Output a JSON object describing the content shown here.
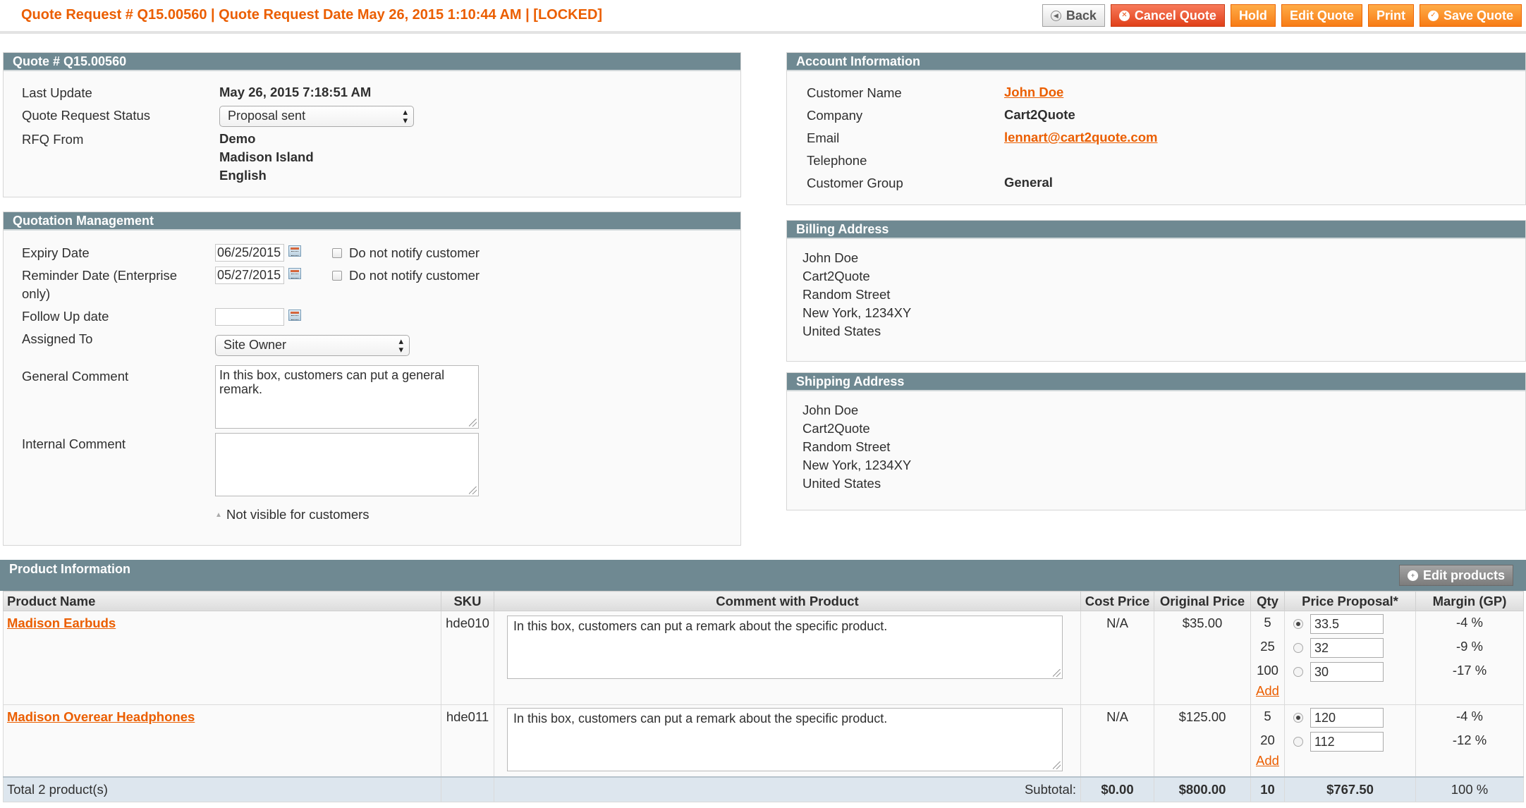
{
  "header": {
    "title": "Quote Request # Q15.00560 | Quote Request Date May 26, 2015 1:10:44 AM | [LOCKED]",
    "buttons": {
      "back": "Back",
      "cancel": "Cancel Quote",
      "hold": "Hold",
      "edit": "Edit Quote",
      "print": "Print",
      "save": "Save Quote"
    }
  },
  "quote": {
    "heading": "Quote # Q15.00560",
    "last_update_label": "Last Update",
    "last_update": "May 26, 2015 7:18:51 AM",
    "status_label": "Quote Request Status",
    "status": "Proposal sent",
    "rfq_label": "RFQ From",
    "rfq_from": [
      "Demo",
      "Madison Island",
      "English"
    ]
  },
  "management": {
    "heading": "Quotation Management",
    "expiry_label": "Expiry Date",
    "expiry_value": "06/25/2015",
    "reminder_label_1": "Reminder Date (Enterprise",
    "reminder_label_2": "only)",
    "reminder_value": "05/27/2015",
    "notify_label": "Do not notify customer",
    "followup_label": "Follow Up date",
    "followup_value": "",
    "assigned_label": "Assigned To",
    "assigned_value": "Site Owner",
    "general_label": "General Comment",
    "general_value": "In this box, customers can put a general remark.",
    "internal_label": "Internal Comment",
    "internal_value": "",
    "internal_note": "Not visible for customers"
  },
  "account": {
    "heading": "Account Information",
    "name_label": "Customer Name",
    "name": "John Doe",
    "company_label": "Company",
    "company": "Cart2Quote",
    "email_label": "Email",
    "email": "lennart@cart2quote.com",
    "phone_label": "Telephone",
    "phone": "",
    "group_label": "Customer Group",
    "group": "General"
  },
  "billing": {
    "heading": "Billing Address",
    "lines": [
      "John Doe",
      "Cart2Quote",
      "Random Street",
      "New York, 1234XY",
      "United States"
    ]
  },
  "shipping": {
    "heading": "Shipping Address",
    "lines": [
      "John Doe",
      "Cart2Quote",
      "Random Street",
      "New York, 1234XY",
      "United States"
    ]
  },
  "products": {
    "heading": "Product Information",
    "edit_button": "Edit products",
    "columns": [
      "Product Name",
      "SKU",
      "Comment with Product",
      "Cost Price",
      "Original Price",
      "Qty",
      "Price Proposal*",
      "Margin (GP)"
    ],
    "add_label": "Add",
    "rows": [
      {
        "name": "Madison Earbuds",
        "sku": "hde010",
        "comment": "In this box, customers can put a remark about the specific product.",
        "cost": "N/A",
        "original": "$35.00",
        "tiers": [
          {
            "qty": "5",
            "proposal": "33.5",
            "margin": "-4 %",
            "selected": true
          },
          {
            "qty": "25",
            "proposal": "32",
            "margin": "-9 %",
            "selected": false
          },
          {
            "qty": "100",
            "proposal": "30",
            "margin": "-17 %",
            "selected": false
          }
        ]
      },
      {
        "name": "Madison Overear Headphones",
        "sku": "hde011",
        "comment": "In this box, customers can put a remark about the specific product.",
        "cost": "N/A",
        "original": "$125.00",
        "tiers": [
          {
            "qty": "5",
            "proposal": "120",
            "margin": "-4 %",
            "selected": true
          },
          {
            "qty": "20",
            "proposal": "112",
            "margin": "-12 %",
            "selected": false
          }
        ]
      }
    ],
    "totals": {
      "count": "Total 2 product(s)",
      "subtotal_label": "Subtotal:",
      "cost": "$0.00",
      "original": "$800.00",
      "qty": "10",
      "proposal": "$767.50",
      "margin": "100 %"
    }
  }
}
